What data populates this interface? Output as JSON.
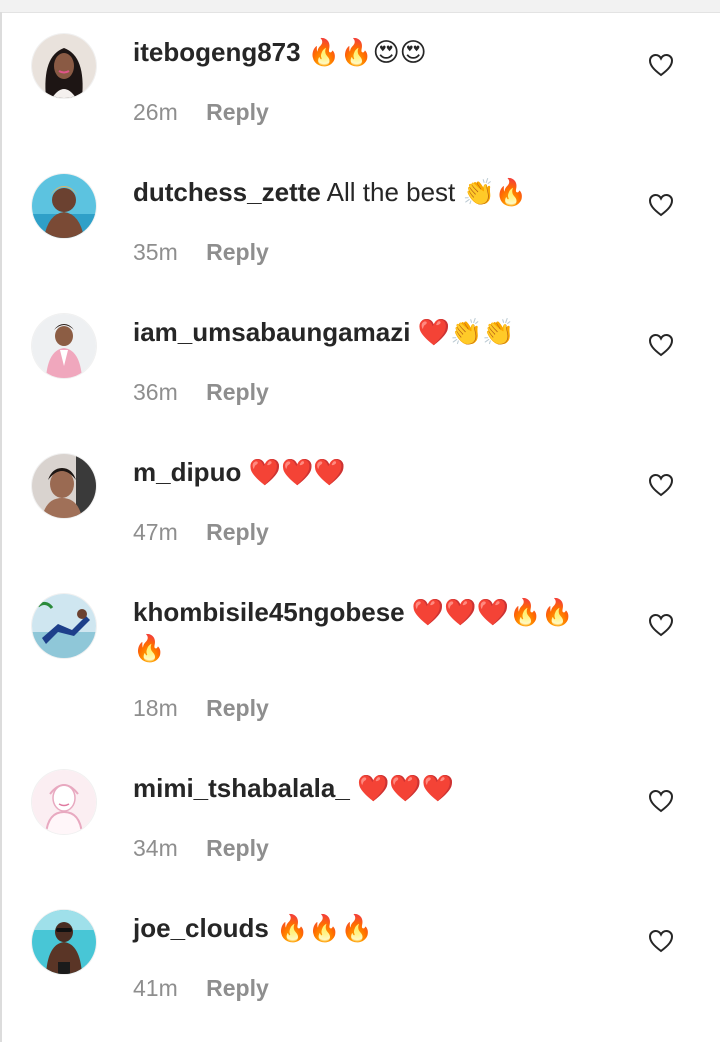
{
  "reply_label": "Reply",
  "comments": [
    {
      "username": "itebogeng873",
      "text": "🔥🔥😍😍",
      "time": "26m"
    },
    {
      "username": "dutchess_zette",
      "text": "All the best 👏🔥",
      "time": "35m"
    },
    {
      "username": "iam_umsabaungamazi",
      "text": "❤️👏👏",
      "time": "36m"
    },
    {
      "username": "m_dipuo",
      "text": "❤️❤️❤️",
      "time": "47m"
    },
    {
      "username": "khombisile45ngobese",
      "text": "❤️❤️❤️🔥🔥🔥",
      "time": "18m"
    },
    {
      "username": "mimi_tshabalala_",
      "text": "❤️❤️❤️",
      "time": "34m"
    },
    {
      "username": "joe_clouds",
      "text": "🔥🔥🔥",
      "time": "41m"
    }
  ]
}
